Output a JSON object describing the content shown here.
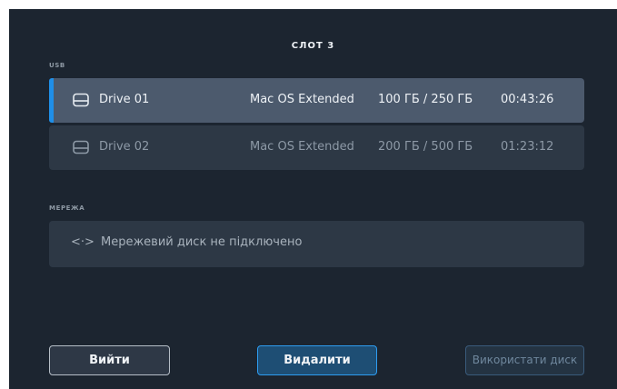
{
  "title": "СЛОТ 3",
  "usb": {
    "label": "USB",
    "drives": [
      {
        "name": "Drive 01",
        "format": "Mac OS Extended",
        "capacity": "100 ГБ / 250 ГБ",
        "time": "00:43:26",
        "selected": true
      },
      {
        "name": "Drive 02",
        "format": "Mac OS Extended",
        "capacity": "200 ГБ / 500 ГБ",
        "time": "01:23:12",
        "selected": false
      }
    ]
  },
  "network": {
    "label": "МЕРЕЖА",
    "icon": "<·>",
    "status": "Мережевий диск не підключено"
  },
  "buttons": {
    "exit": "Вийти",
    "delete": "Видалити",
    "use_disk": "Використати диск"
  },
  "colors": {
    "accent": "#1f8fe8",
    "background": "#1c2530"
  }
}
